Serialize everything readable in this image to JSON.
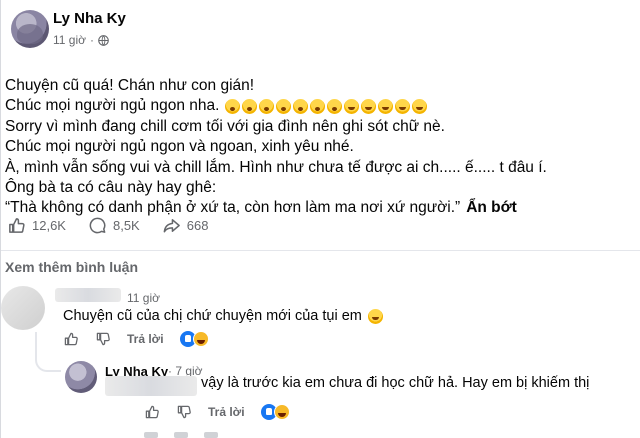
{
  "post": {
    "author": "Ly Nha Ky",
    "time": "11 giờ",
    "lines": [
      "Chuyện cũ quá! Chán như con gián!",
      "Chúc mọi người ngủ ngon nha.",
      "Sorry vì mình đang chill cơm tối với gia đình nên ghi sót chữ nè.",
      "Chúc mọi người ngủ ngon và ngoan, xinh yêu nhé.",
      "À, mình vẫn sống vui và chill lắm. Hình như chưa tế được ai ch..... ế..... t đâu í.",
      "Ông bà ta có câu này hay ghê:",
      "“Thà không có danh phận ở xứ ta, còn hơn làm ma nơi xứ người.”"
    ],
    "see_less": "Ẩn bớt",
    "emoji_icons": [
      "open-mouth-emoji",
      "open-mouth-emoji",
      "open-mouth-emoji",
      "open-mouth-emoji",
      "open-mouth-emoji",
      "open-mouth-emoji",
      "open-mouth-emoji",
      "wink-emoji",
      "wink-emoji",
      "wink-emoji",
      "wink-emoji",
      "wink-emoji"
    ]
  },
  "stats": {
    "likes": "12,6K",
    "comments": "8,5K",
    "shares": "668"
  },
  "more_comments": "Xem thêm bình luận",
  "comment1": {
    "time": "11 giờ",
    "text": "Chuyện cũ của chị chứ chuyện mới của tụi em",
    "reply_label": "Trả lời"
  },
  "reply1": {
    "author": "Ly Nha Ky",
    "time": "· 7 giờ",
    "text": "vậy là trước kia em chưa đi học chữ hả. Hay em bị khiếm thị",
    "reply_label": "Trả lời"
  },
  "colors": {
    "text": "#050505",
    "secondary": "#65676b",
    "like_blue": "#1877f2",
    "haha_yellow": "#f7b928"
  }
}
